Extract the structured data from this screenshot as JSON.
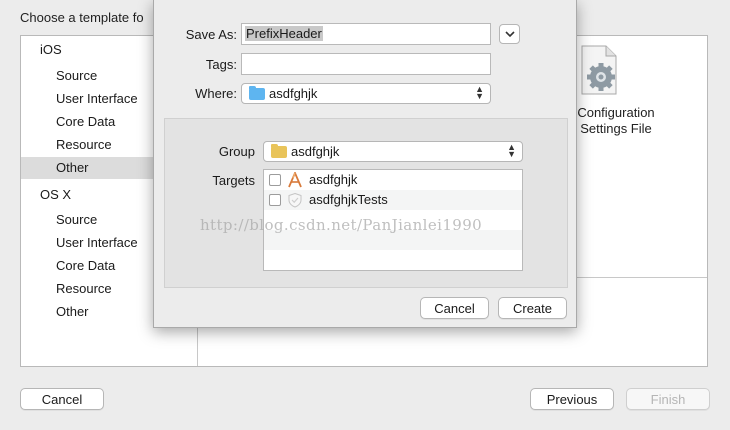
{
  "chooser": {
    "title": "Choose a template fo",
    "categories": [
      {
        "header": "iOS",
        "items": [
          "Source",
          "User Interface",
          "Core Data",
          "Resource",
          "Other"
        ]
      },
      {
        "header": "OS X",
        "items": [
          "Source",
          "User Interface",
          "Core Data",
          "Resource",
          "Other"
        ]
      }
    ],
    "selected_item": "iOS / Other",
    "template": {
      "label_line1": "Configuration",
      "label_line2": "Settings File",
      "icon": "gear-document-icon"
    },
    "buttons": {
      "cancel": "Cancel",
      "previous": "Previous",
      "finish": "Finish"
    }
  },
  "sheet": {
    "save_as_label": "Save As:",
    "save_as_value": "PrefixHeader",
    "tags_label": "Tags:",
    "tags_value": "",
    "where_label": "Where:",
    "where_value": "asdfghjk",
    "group_label": "Group",
    "group_value": "asdfghjk",
    "targets_label": "Targets",
    "targets": [
      {
        "name": "asdfghjk",
        "checked": false,
        "icon": "app-target-icon"
      },
      {
        "name": "asdfghjkTests",
        "checked": false,
        "icon": "test-target-icon"
      }
    ],
    "buttons": {
      "cancel": "Cancel",
      "create": "Create"
    },
    "colors": {
      "blue_folder": "#5eb5f0",
      "yellow_folder": "#e9c45a"
    }
  },
  "watermark": "http://blog.csdn.net/PanJianlei1990"
}
